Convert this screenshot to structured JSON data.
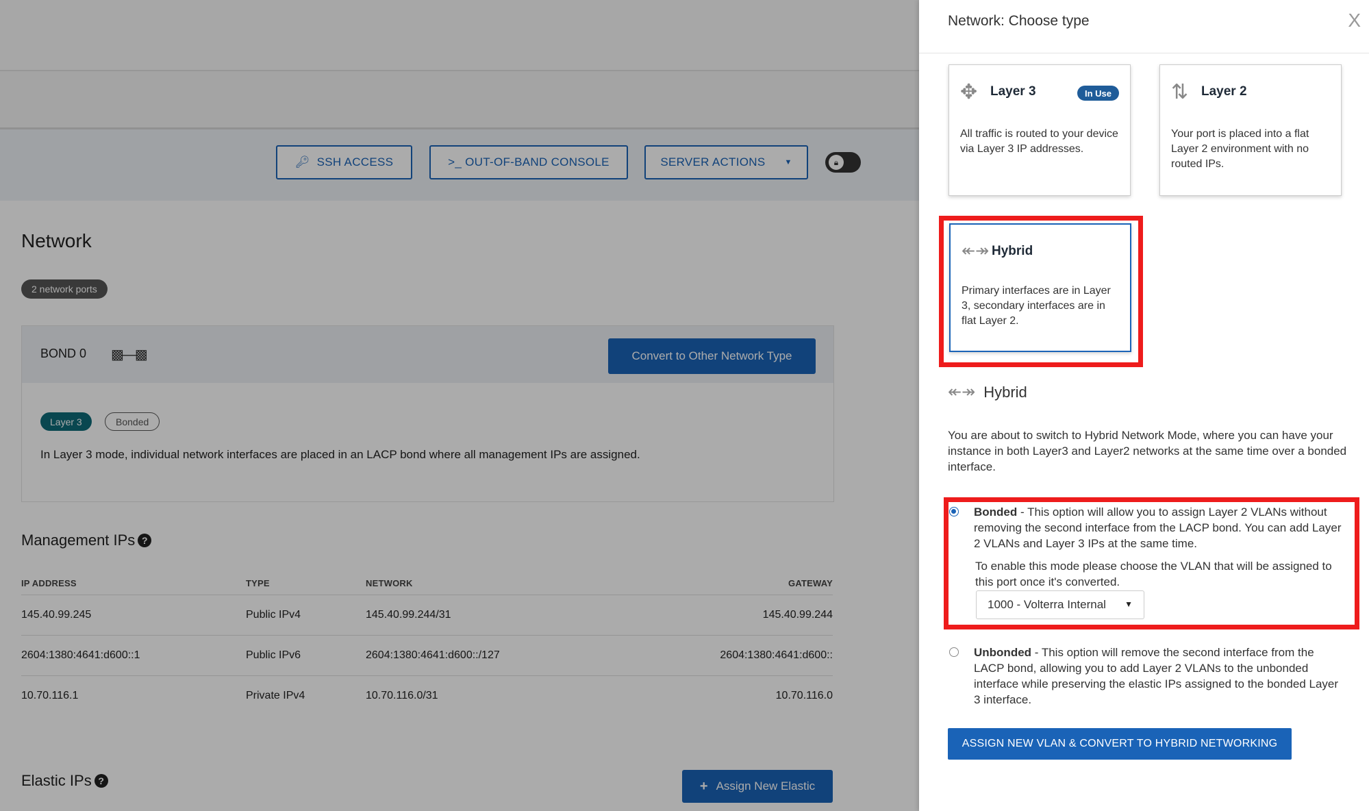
{
  "toolbar": {
    "ssh_label": "SSH ACCESS",
    "oob_label": ">_ OUT-OF-BAND CONSOLE",
    "server_actions_label": "SERVER ACTIONS"
  },
  "network": {
    "title": "Network",
    "ports_badge": "2 network ports",
    "bond": {
      "name": "BOND 0",
      "convert_button": "Convert to Other Network Type",
      "tags": [
        "Layer 3",
        "Bonded"
      ],
      "description": "In Layer 3 mode, individual network interfaces are placed in an LACP bond where all management IPs are assigned."
    }
  },
  "management_ips": {
    "title": "Management IPs",
    "columns": [
      "IP ADDRESS",
      "TYPE",
      "NETWORK",
      "GATEWAY"
    ],
    "rows": [
      [
        "145.40.99.245",
        "Public IPv4",
        "145.40.99.244/31",
        "145.40.99.244"
      ],
      [
        "2604:1380:4641:d600::1",
        "Public IPv6",
        "2604:1380:4641:d600::/127",
        "2604:1380:4641:d600::"
      ],
      [
        "10.70.116.1",
        "Private IPv4",
        "10.70.116.0/31",
        "10.70.116.0"
      ]
    ]
  },
  "elastic_ips": {
    "title": "Elastic IPs",
    "assign_button": "Assign New Elastic"
  },
  "drawer": {
    "title": "Network: Choose type",
    "close": "X",
    "cards": {
      "layer3": {
        "title": "Layer 3",
        "badge": "In Use",
        "description": "All traffic is routed to your device via Layer 3 IP addresses."
      },
      "layer2": {
        "title": "Layer 2",
        "description": "Your port is placed into a flat Layer 2 environment with no routed IPs."
      },
      "hybrid": {
        "title": "Hybrid",
        "description": "Primary interfaces are in Layer 3, secondary interfaces are in flat Layer 2."
      }
    },
    "hybrid_section": {
      "title": "Hybrid",
      "description": "You are about to switch to Hybrid Network Mode, where you can have your instance in both Layer3 and Layer2 networks at the same time over a bonded interface."
    },
    "options": {
      "bonded": {
        "label": "Bonded",
        "text": " - This option will allow you to assign Layer 2 VLANs without removing the second interface from the LACP bond. You can add Layer 2 VLANs and Layer 3 IPs at the same time.",
        "vlan_prompt": "To enable this mode please choose the VLAN that will be assigned to this port once it's converted.",
        "vlan_selected": "1000 - Volterra Internal",
        "selected": true
      },
      "unbonded": {
        "label": "Unbonded",
        "text": " - This option will remove the second interface from the LACP bond, allowing you to add Layer 2 VLANs to the unbonded interface while preserving the elastic IPs assigned to the bonded Layer 3 interface.",
        "selected": false
      }
    },
    "cta": "ASSIGN NEW VLAN & CONVERT TO HYBRID NETWORKING"
  },
  "colors": {
    "primary": "#1a63b7",
    "highlight": "#ee1c1c",
    "tag_teal": "#0e6b78",
    "badge_inuse": "#1f5c99"
  }
}
